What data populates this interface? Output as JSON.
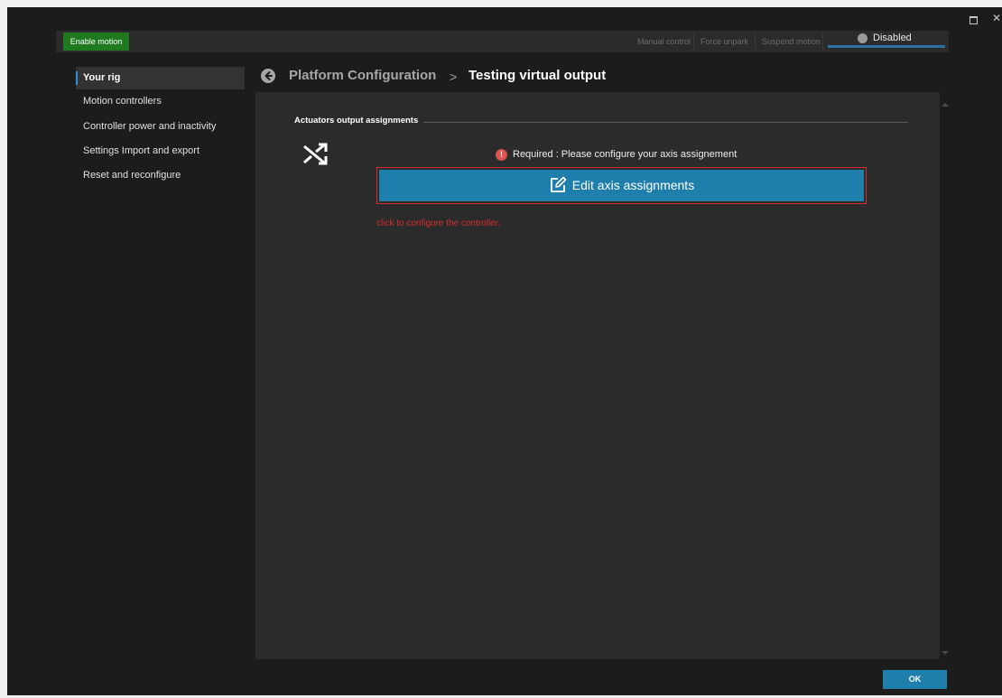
{
  "window": {
    "title_buttons": [
      "maximize-icon",
      "close-icon"
    ]
  },
  "topbar": {
    "enable_motion": "Enable motion",
    "manual_control": "Manual control",
    "force_unpark": "Force unpark",
    "suspend_motion": "Suspend motion",
    "status_label": "Disabled"
  },
  "sidebar": {
    "items": [
      {
        "label": "Your rig",
        "active": true
      },
      {
        "label": "Motion controllers",
        "active": false
      },
      {
        "label": "Controller power and inactivity",
        "active": false
      },
      {
        "label": "Settings Import and export",
        "active": false
      },
      {
        "label": "Reset and reconfigure",
        "active": false
      }
    ]
  },
  "breadcrumb": {
    "root": "Platform Configuration",
    "separator": ">",
    "current": "Testing virtual output"
  },
  "section": {
    "title": "Actuators output assignments",
    "icon": "shuffle-icon",
    "required_icon": "!",
    "required_text": "Required : Please configure your axis assignement",
    "edit_button": "Edit axis assignments",
    "hint": "click to configure the controller."
  },
  "footer": {
    "ok": "OK"
  },
  "colors": {
    "accent_blue": "#1e7eac",
    "enable_green": "#1f7a1f",
    "error_red": "#d32f2f",
    "panel_bg": "#2b2b2b",
    "window_bg": "#1c1c1c"
  }
}
